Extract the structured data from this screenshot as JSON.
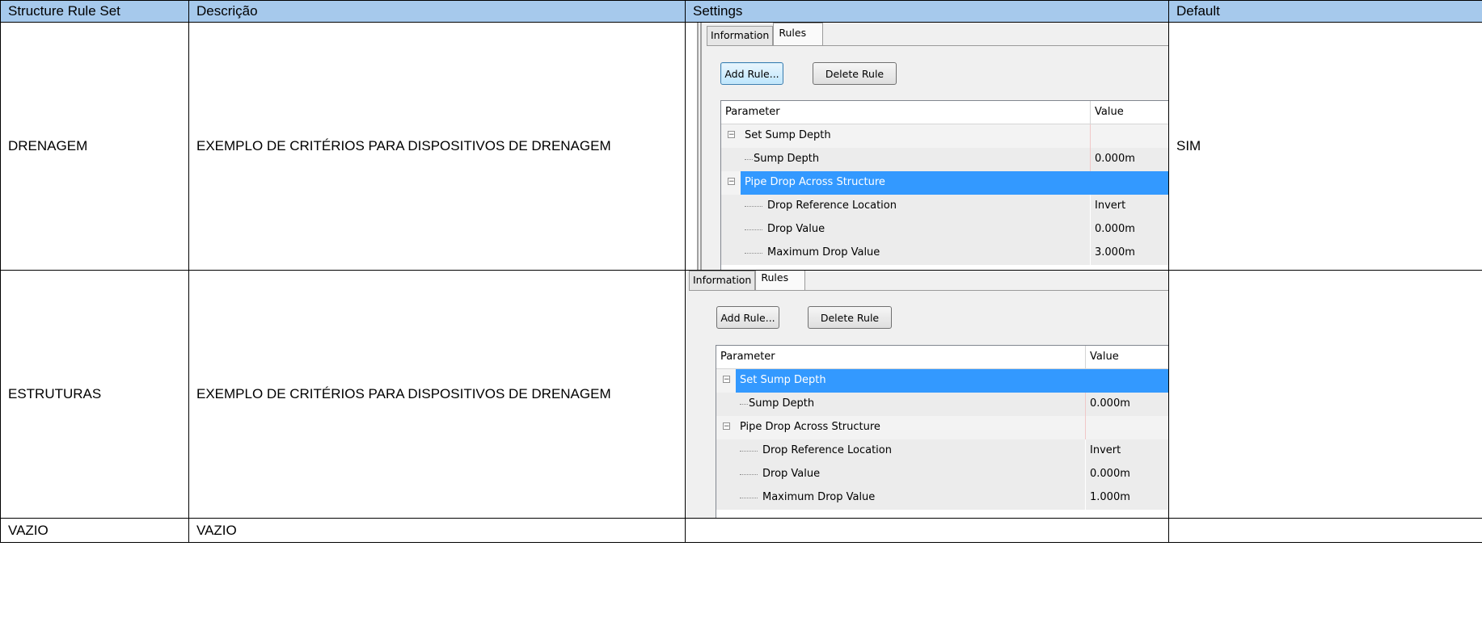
{
  "table": {
    "headers": [
      "Structure Rule Set",
      "Descrição",
      "Settings",
      "Default"
    ],
    "rows": [
      {
        "name": "DRENAGEM",
        "description": "EXEMPLO DE CRITÉRIOS PARA DISPOSITIVOS DE DRENAGEM",
        "default": "SIM",
        "settings": {
          "tabs": [
            "Information",
            "Rules"
          ],
          "active_tab": "Rules",
          "buttons": [
            "Add Rule...",
            "Delete Rule"
          ],
          "columns": [
            "Parameter",
            "Value"
          ],
          "rules": [
            {
              "name": "Set Sump Depth",
              "selected": false,
              "params": [
                {
                  "name": "Sump Depth",
                  "value": "0.000m"
                }
              ]
            },
            {
              "name": "Pipe Drop Across Structure",
              "selected": true,
              "params": [
                {
                  "name": "Drop Reference Location",
                  "value": "Invert"
                },
                {
                  "name": "Drop Value",
                  "value": "0.000m"
                },
                {
                  "name": "Maximum Drop Value",
                  "value": "3.000m"
                }
              ]
            }
          ]
        }
      },
      {
        "name": "ESTRUTURAS",
        "description": "EXEMPLO DE CRITÉRIOS PARA DISPOSITIVOS DE DRENAGEM",
        "default": "",
        "settings": {
          "tabs": [
            "Information",
            "Rules"
          ],
          "active_tab": "Rules",
          "buttons": [
            "Add Rule...",
            "Delete Rule"
          ],
          "columns": [
            "Parameter",
            "Value"
          ],
          "rules": [
            {
              "name": "Set Sump Depth",
              "selected": true,
              "params": [
                {
                  "name": "Sump Depth",
                  "value": "0.000m"
                }
              ]
            },
            {
              "name": "Pipe Drop Across Structure",
              "selected": false,
              "params": [
                {
                  "name": "Drop Reference Location",
                  "value": "Invert"
                },
                {
                  "name": "Drop Value",
                  "value": "0.000m"
                },
                {
                  "name": "Maximum Drop Value",
                  "value": "1.000m"
                }
              ]
            }
          ]
        }
      },
      {
        "name": "VAZIO",
        "description": "VAZIO",
        "default": ""
      }
    ]
  },
  "colors": {
    "header_bg": "#a6c9ec",
    "selection": "#3399ff",
    "panel_bg": "#f0f0f0"
  }
}
